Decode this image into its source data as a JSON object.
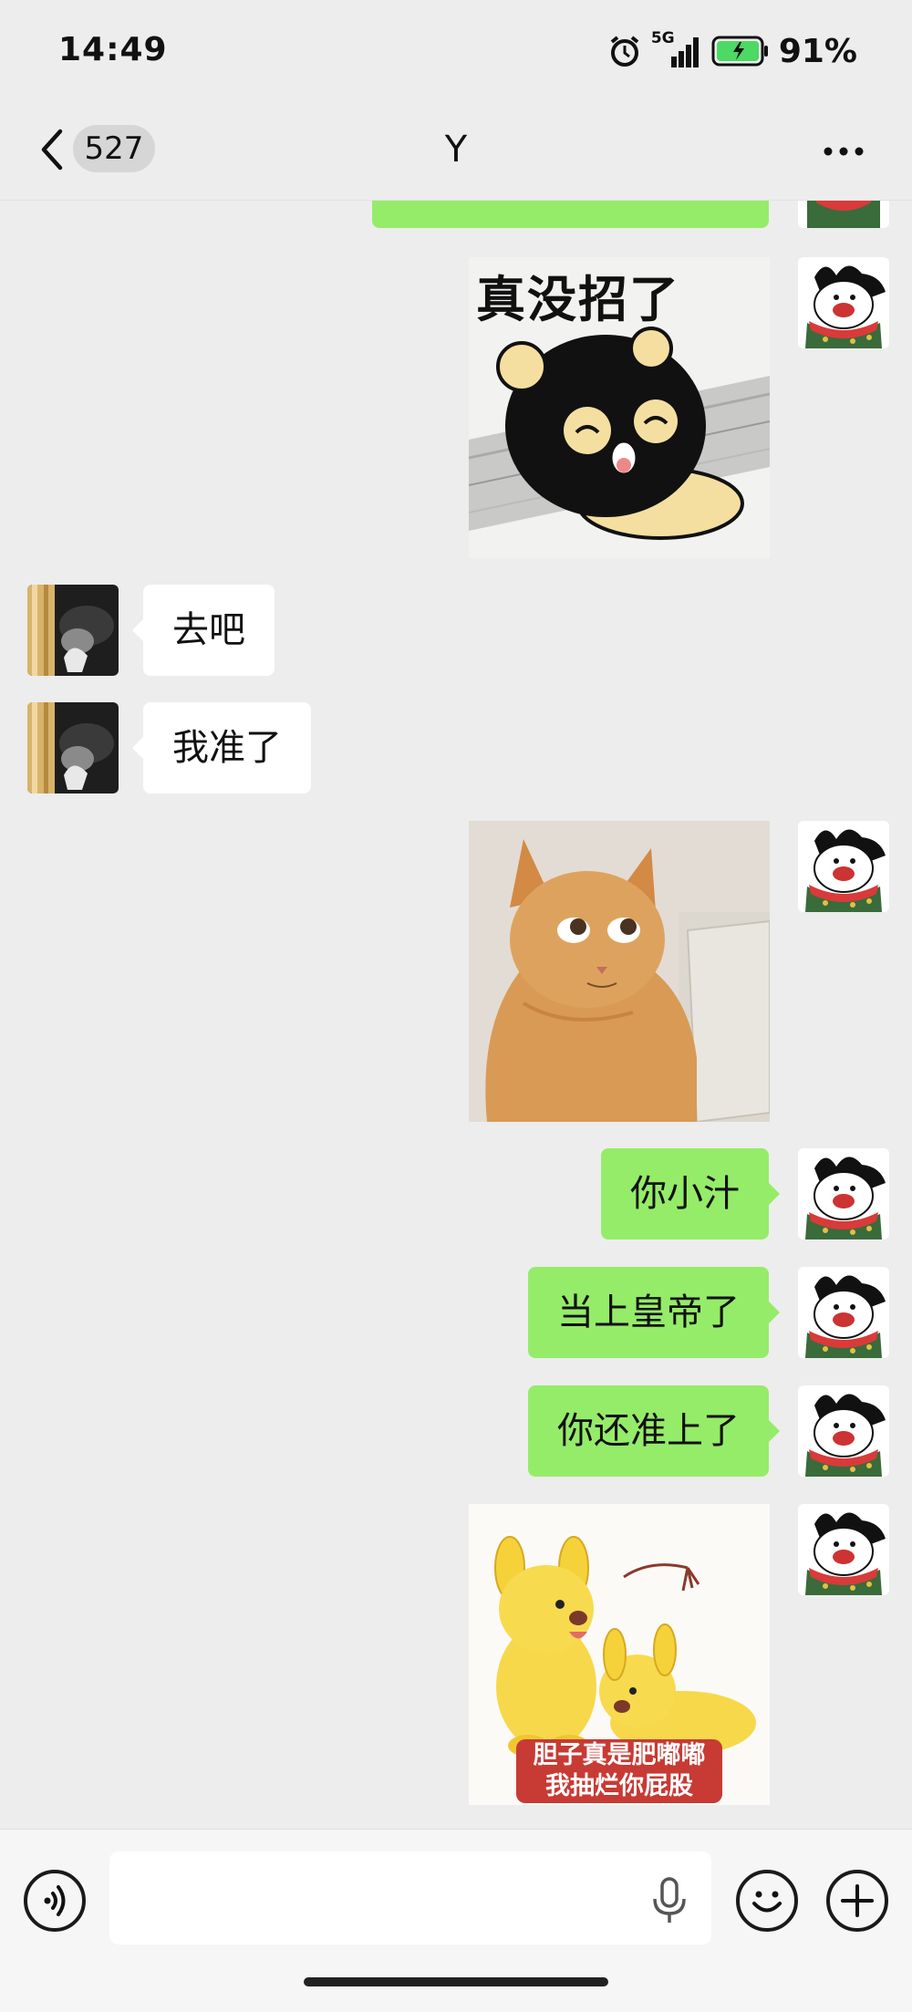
{
  "status_bar": {
    "time": "14:49",
    "network": "5G",
    "battery_pct": "91%",
    "battery_level": 0.91
  },
  "nav": {
    "unread_count": "527",
    "title": "Y"
  },
  "messages": {
    "in_1": "去吧",
    "in_2": "我准了",
    "out_1": "你小汁",
    "out_2": "当上皇帝了",
    "out_3": "你还准上了"
  },
  "stickers": {
    "sticker_1_caption": "真没招了",
    "sticker_3_line1": "胆子真是肥嘟嘟",
    "sticker_3_line2": "我抽烂你屁股"
  },
  "colors": {
    "outgoing_bubble": "#95ec69",
    "incoming_bubble": "#ffffff",
    "background": "#ededed"
  },
  "icons": [
    "back-icon",
    "more-icon",
    "voice-icon",
    "mic-icon",
    "emoji-icon",
    "plus-icon"
  ]
}
